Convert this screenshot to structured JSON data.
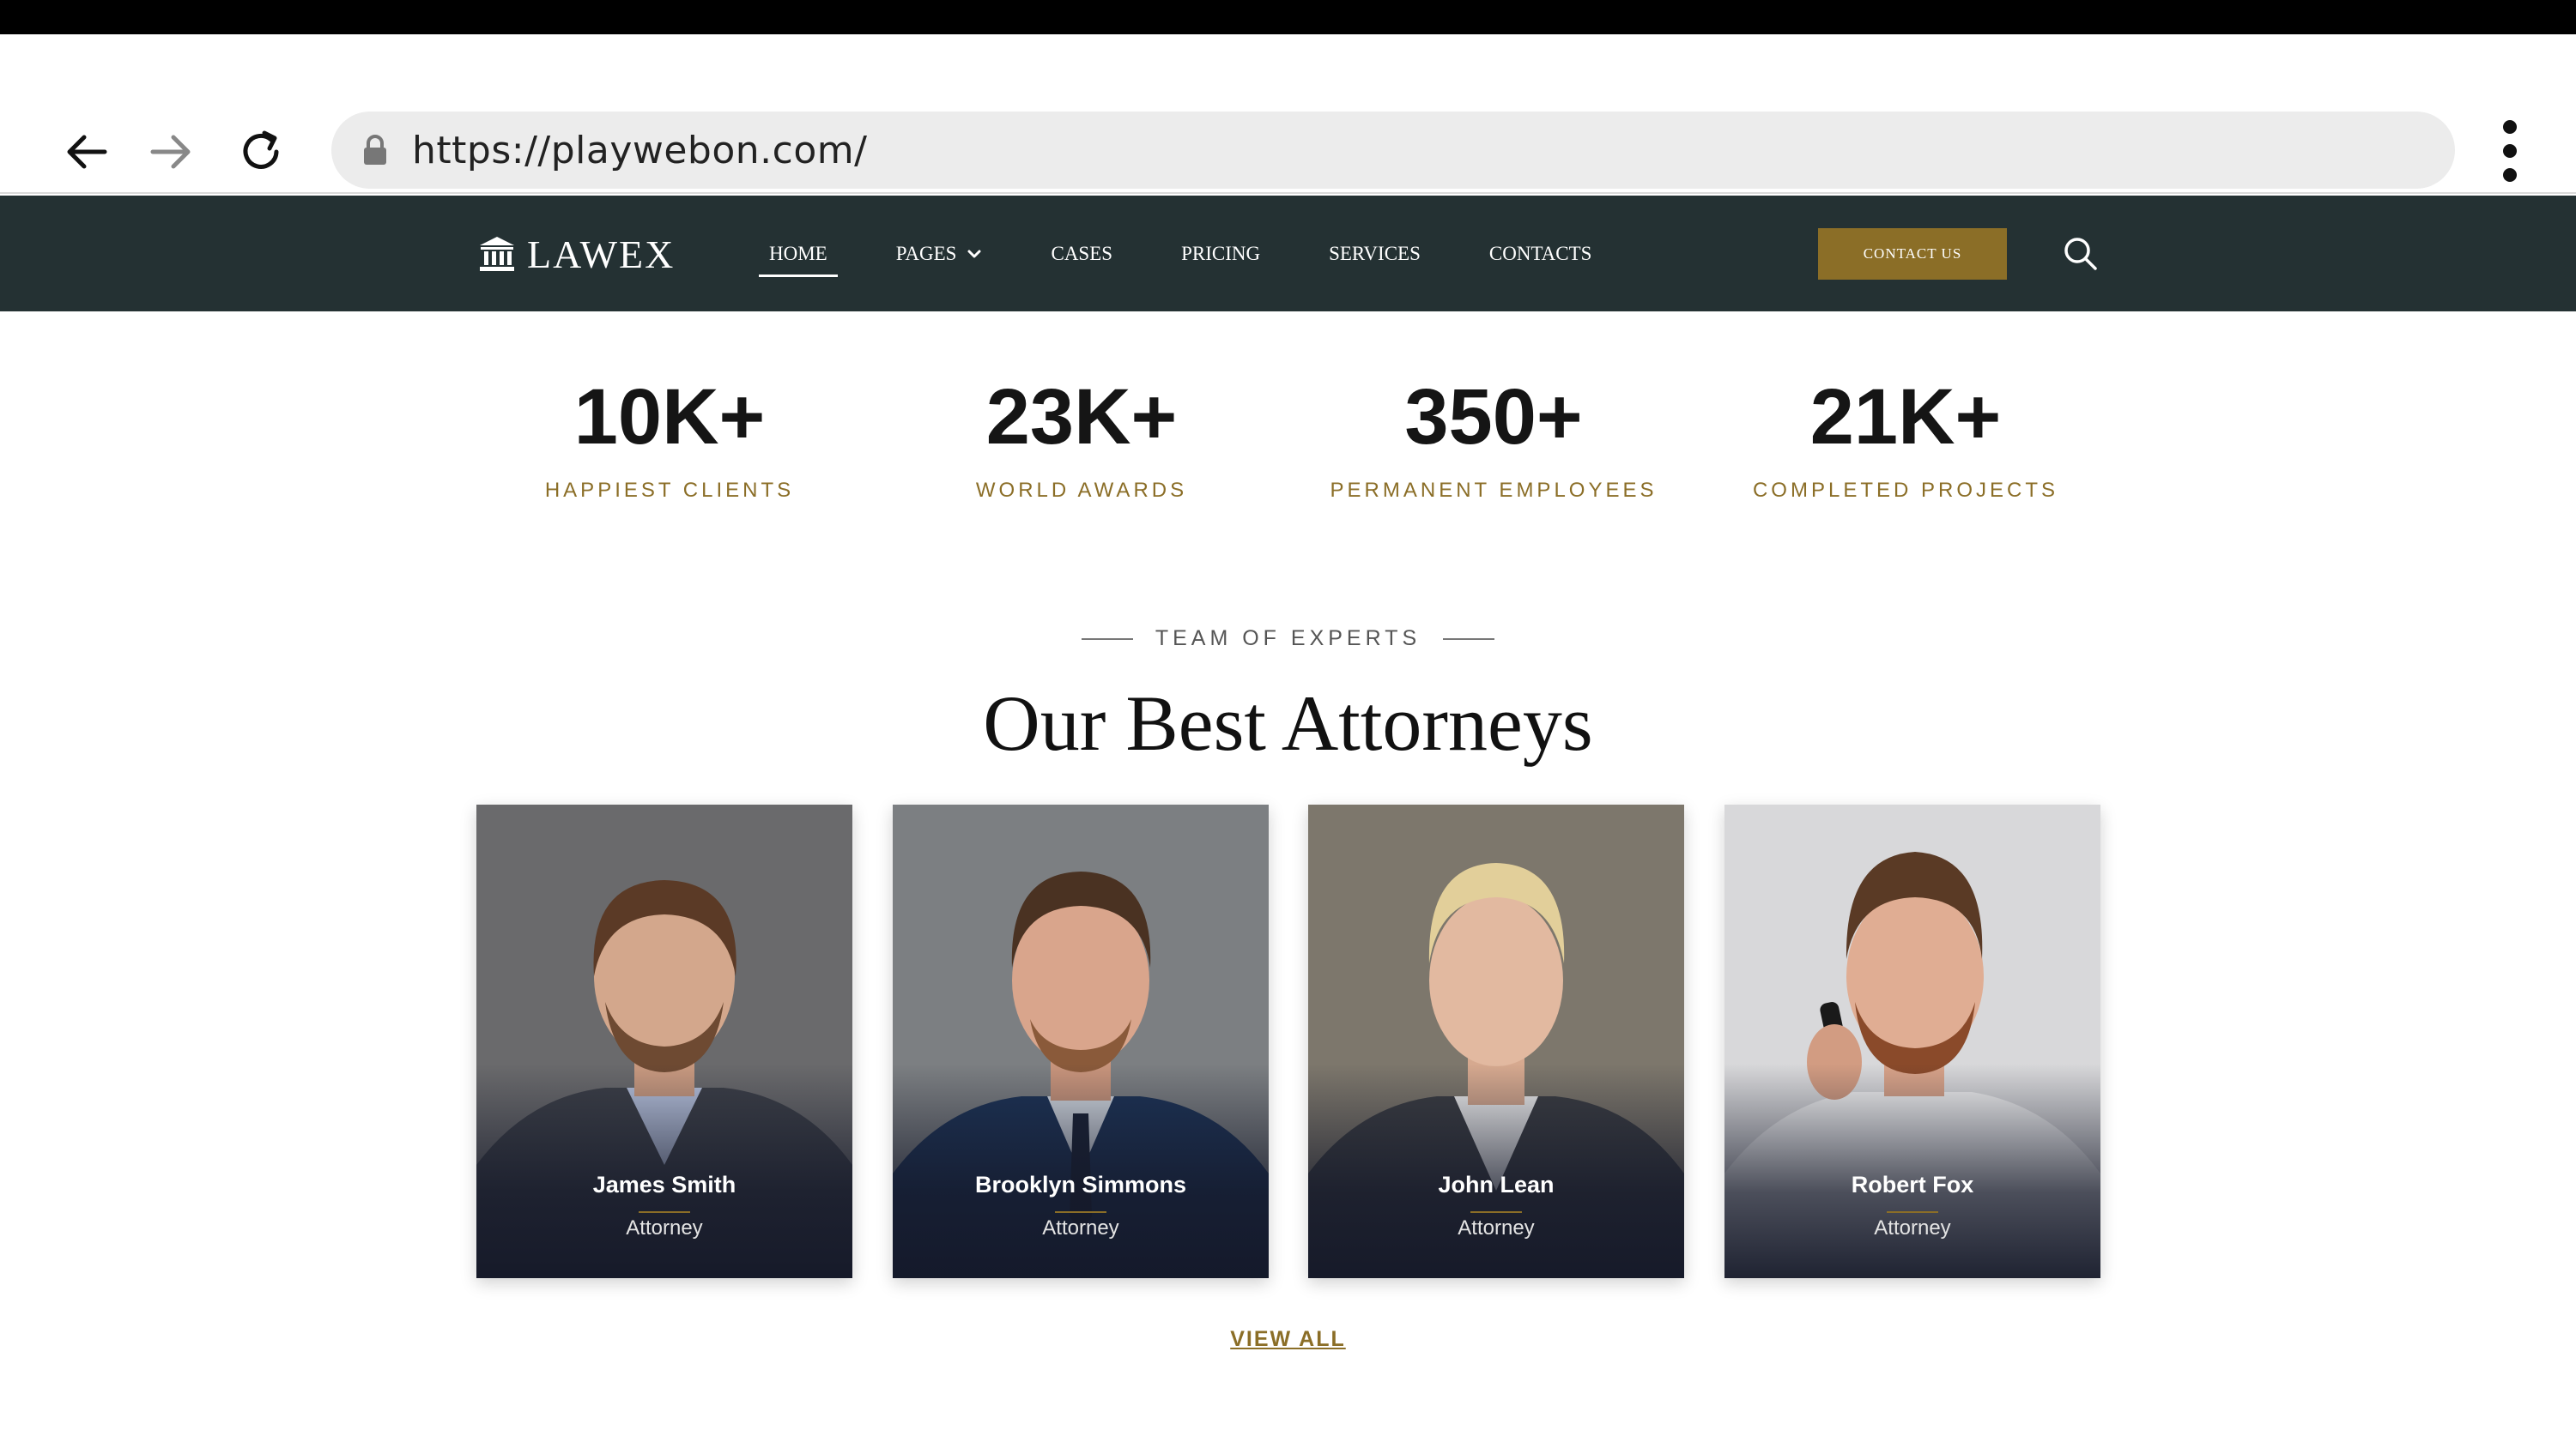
{
  "browser": {
    "url": "https://playwebon.com/",
    "icons": [
      "back-arrow-icon",
      "forward-arrow-icon",
      "reload-icon",
      "lock-icon",
      "kebab-menu-icon"
    ]
  },
  "header": {
    "logo_text": "LAWEX",
    "logo_icon": "courthouse-icon",
    "nav": [
      {
        "label": "HOME",
        "active": true
      },
      {
        "label": "PAGES",
        "has_dropdown": true
      },
      {
        "label": "CASES"
      },
      {
        "label": "PRICING"
      },
      {
        "label": "SERVICES"
      },
      {
        "label": "CONTACTS"
      }
    ],
    "cta_label": "CONTACT US",
    "search_icon": "search-icon"
  },
  "stats": [
    {
      "value": "10K+",
      "label": "HAPPIEST CLIENTS"
    },
    {
      "value": "23K+",
      "label": "WORLD AWARDS"
    },
    {
      "value": "350+",
      "label": "PERMANENT EMPLOYEES"
    },
    {
      "value": "21K+",
      "label": "COMPLETED PROJECTS"
    }
  ],
  "team": {
    "eyebrow": "TEAM OF EXPERTS",
    "title": "Our Best Attorneys",
    "members": [
      {
        "name": "James Smith",
        "role": "Attorney"
      },
      {
        "name": "Brooklyn Simmons",
        "role": "Attorney"
      },
      {
        "name": "John Lean",
        "role": "Attorney"
      },
      {
        "name": "Robert Fox",
        "role": "Attorney"
      }
    ],
    "view_all": "VIEW ALL"
  },
  "colors": {
    "accent": "#8b6e27",
    "header_bg": "#243133",
    "url_bar_bg": "#ececec"
  }
}
